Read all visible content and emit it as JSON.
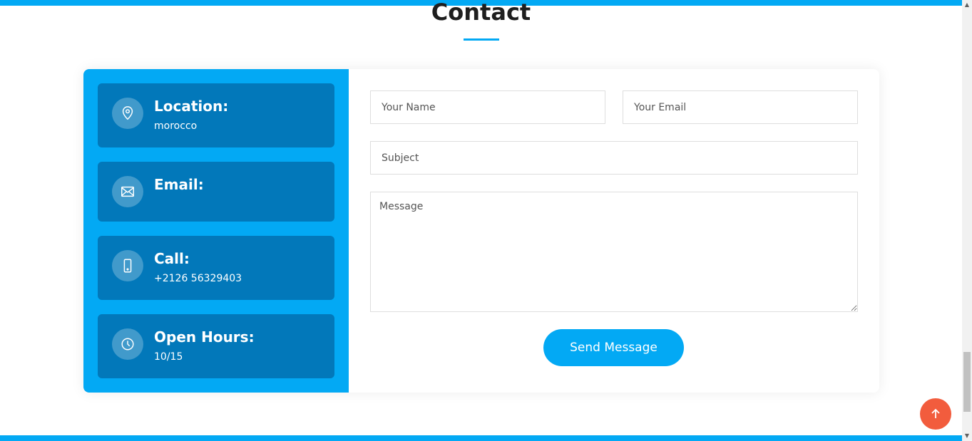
{
  "section": {
    "title": "Contact"
  },
  "info": {
    "location": {
      "heading": "Location:",
      "value": "morocco",
      "icon": "map-pin-icon"
    },
    "email": {
      "heading": "Email:",
      "value": "",
      "icon": "envelope-icon"
    },
    "call": {
      "heading": "Call:",
      "value": "+2126 56329403",
      "icon": "phone-icon"
    },
    "hours": {
      "heading": "Open Hours:",
      "value": "10/15",
      "icon": "clock-icon"
    }
  },
  "form": {
    "name_placeholder": "Your Name",
    "email_placeholder": "Your Email",
    "subject_placeholder": "Subject",
    "message_placeholder": "Message",
    "submit_label": "Send Message"
  },
  "colors": {
    "accent": "#03a9f4",
    "info_box": "#0278ba",
    "back_to_top": "#f25c3d"
  },
  "back_to_top": {
    "icon": "arrow-up-icon"
  }
}
